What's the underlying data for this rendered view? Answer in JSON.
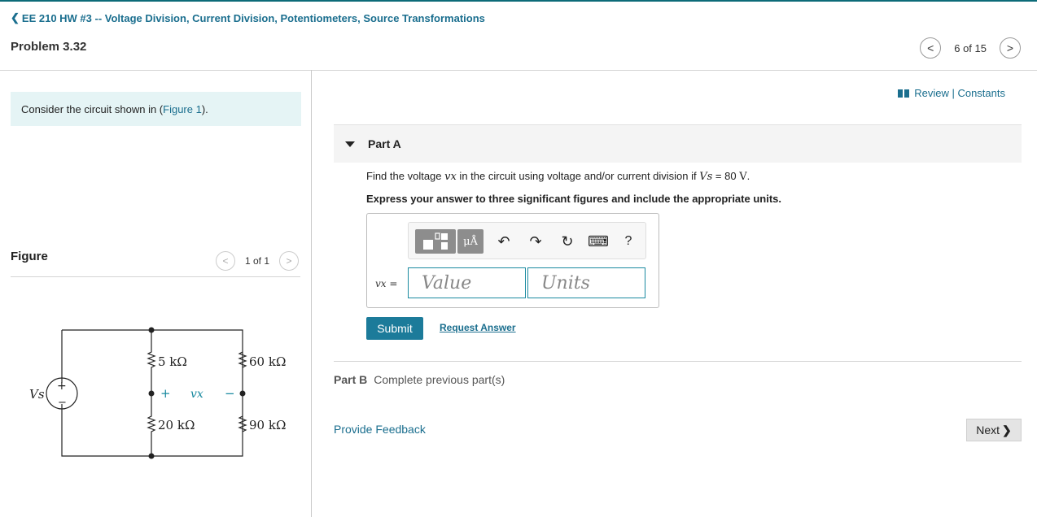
{
  "header": {
    "breadcrumb": "EE 210 HW #3 -- Voltage Division, Current Division, Potentiometers, Source Transformations",
    "problem_title": "Problem 3.32",
    "pager": "6 of 15"
  },
  "left": {
    "consider_text": "Consider the circuit shown in (",
    "consider_link": "Figure 1",
    "consider_end": ").",
    "figure_label": "Figure",
    "figure_pager": "1 of 1"
  },
  "circuit": {
    "source_label": "Vs",
    "source_plus": "+",
    "source_minus": "−",
    "r1": "5 kΩ",
    "r2": "60 kΩ",
    "r3": "20 kΩ",
    "r4": "90 kΩ",
    "vx_plus": "+",
    "vx_label": "vx",
    "vx_minus": "−"
  },
  "right": {
    "review_text": "Review | Constants",
    "part_a_label": "Part A",
    "question_pre": "Find the voltage ",
    "question_var": "vx",
    "question_mid": " in the circuit using voltage and/or current division if ",
    "question_vs": "Vs",
    "question_eq": " = 80 ",
    "question_unit": "V",
    "question_end": ".",
    "instruction": "Express your answer to three significant figures and include the appropriate units.",
    "answer_label": "vx =",
    "value_placeholder": "Value",
    "units_placeholder": "Units",
    "toolbar": {
      "mu_label": "μÅ",
      "undo_glyph": "↶",
      "redo_glyph": "↷",
      "reset_glyph": "↻",
      "keyboard_glyph": "⌨",
      "help_glyph": "?"
    },
    "submit_label": "Submit",
    "request_answer_label": "Request Answer",
    "part_b_label": "Part B",
    "part_b_text": "Complete previous part(s)",
    "feedback_label": "Provide Feedback",
    "next_label": "Next"
  },
  "colors": {
    "accent": "#1a6e8e",
    "submit": "#1c7b9a",
    "consider_bg": "#e5f4f5"
  }
}
